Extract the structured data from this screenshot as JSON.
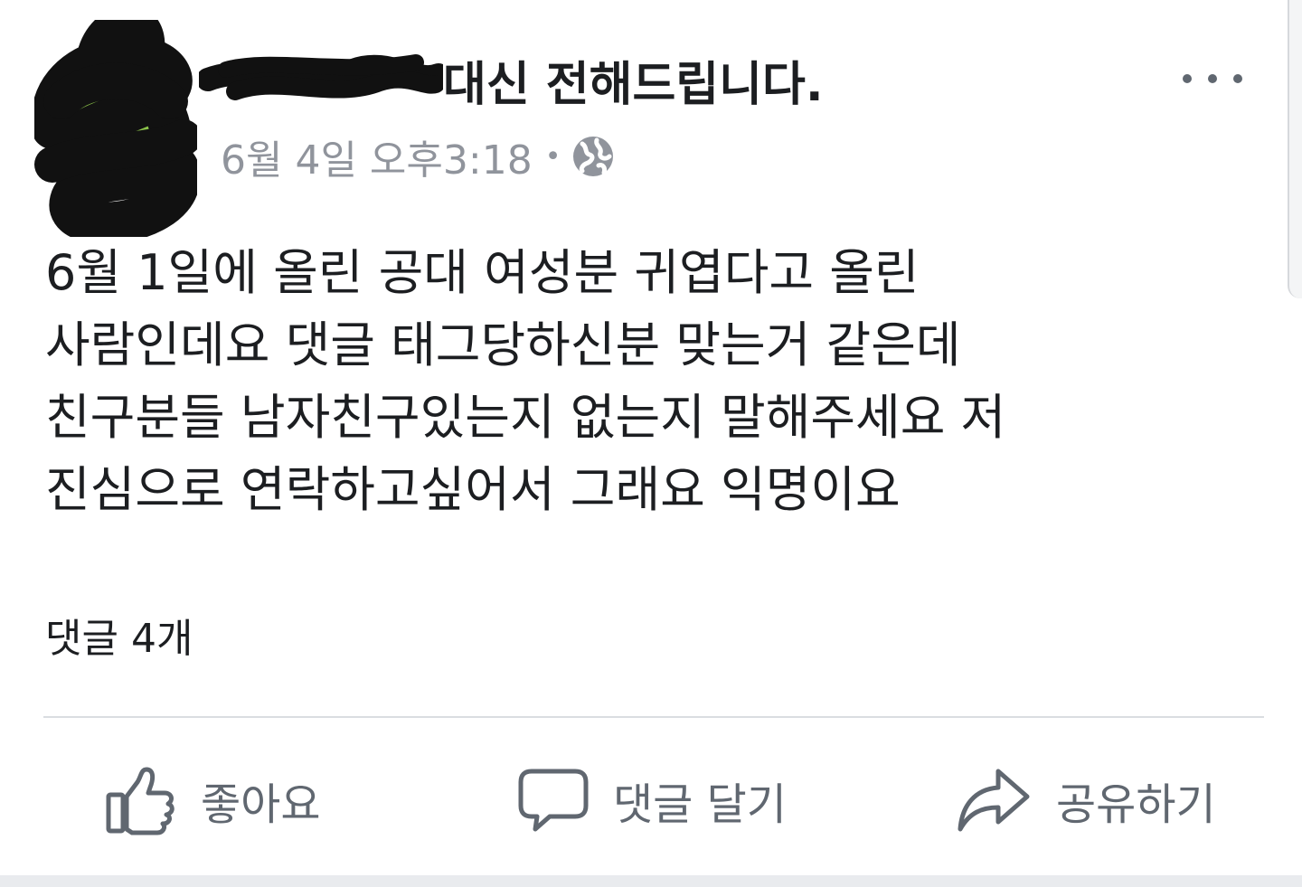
{
  "post": {
    "author_visible_suffix": "대신 전해드립니다.",
    "timestamp": "6월 4일 오후3:18",
    "separator": "•",
    "privacy_icon": "globe-icon",
    "more_icon": "more-horizontal-icon",
    "body": "6월 1일에 올린 공대 여성분 귀엽다고 올린\n사람인데요 댓글 태그당하신분 맞는거 같은데\n친구분들 남자친구있는지 없는지 말해주세요 저\n진심으로 연락하고싶어서 그래요 익명이요"
  },
  "stats": {
    "comment_count": "댓글 4개"
  },
  "actions": {
    "like_label": "좋아요",
    "like_icon": "thumbs-up-icon",
    "comment_label": "댓글 달기",
    "comment_icon": "speech-bubble-icon",
    "share_label": "공유하기",
    "share_icon": "share-arrow-icon"
  },
  "colors": {
    "text_primary": "#1c1e21",
    "text_secondary": "#90949c",
    "icon_gray": "#606770",
    "divider": "#dadde1"
  }
}
